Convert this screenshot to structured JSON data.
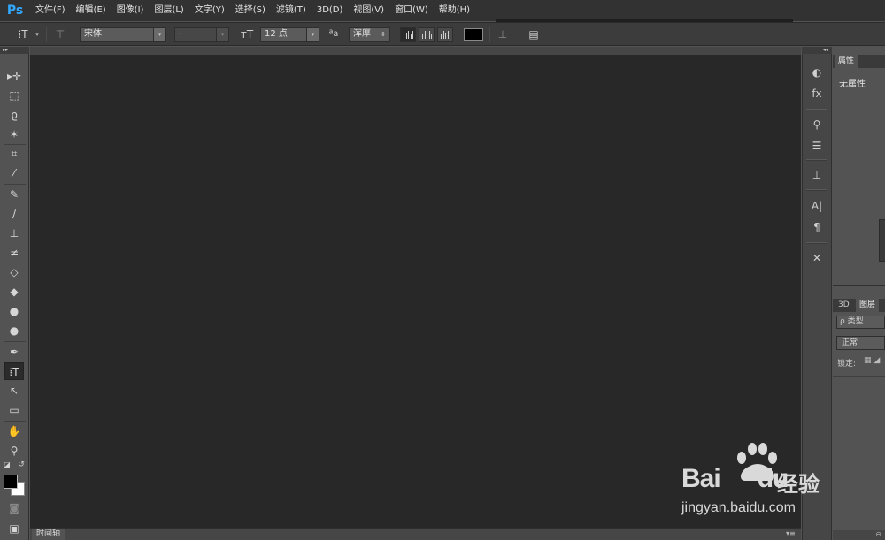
{
  "app": {
    "logo": "Ps"
  },
  "menu": [
    "文件(F)",
    "编辑(E)",
    "图像(I)",
    "图层(L)",
    "文字(Y)",
    "选择(S)",
    "滤镜(T)",
    "3D(D)",
    "视图(V)",
    "窗口(W)",
    "帮助(H)"
  ],
  "options": {
    "font_family": "宋体",
    "font_style": "-",
    "font_size": "12 点",
    "antialias": "浑厚"
  },
  "colors": {
    "accent": "#31a8ff",
    "text_color": "#000000"
  },
  "icons": {
    "tool_preset": "type-tool-icon",
    "orientation": "text-orientation-icon",
    "size": "font-size-icon",
    "antialias": "antialias-icon",
    "warp": "warp-text-icon",
    "panels": "character-panel-icon"
  },
  "right": {
    "properties_tab": "属性",
    "properties_empty": "无属性",
    "tab_3d": "3D",
    "tab_layers": "图层",
    "layers_filter": "ρ 类型",
    "blend_mode": "正常",
    "lock_label": "锁定:"
  },
  "timeline": {
    "tab": "时间轴"
  },
  "watermark": {
    "brand": "Bai",
    "brand_suffix": "du",
    "cn": "经验",
    "url": "jingyan.baidu.com"
  }
}
